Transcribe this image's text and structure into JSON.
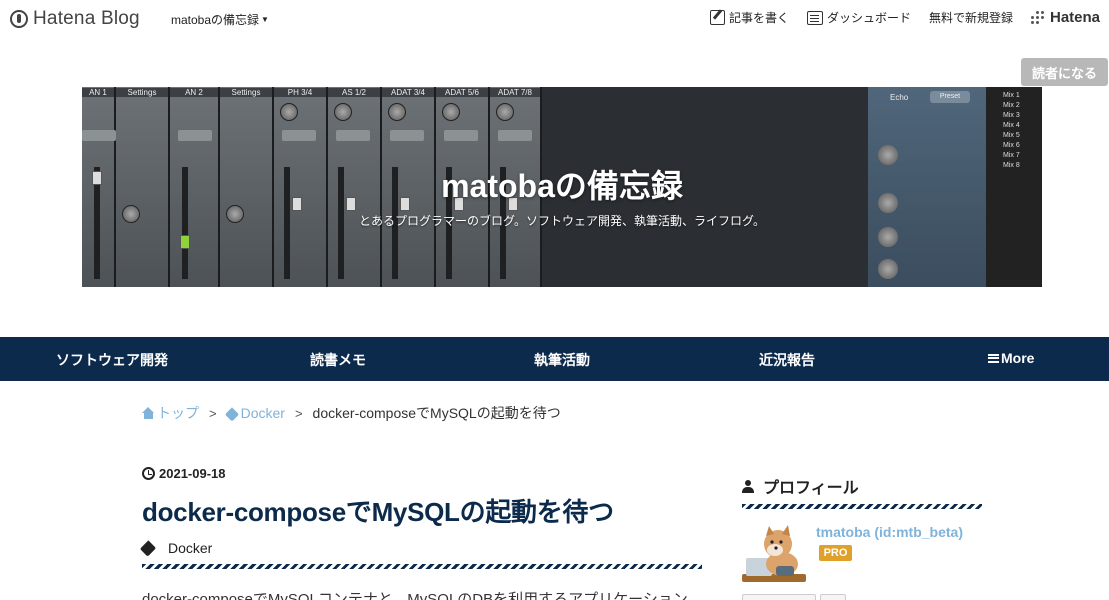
{
  "topbar": {
    "logo_text": "Hatena Blog",
    "blog_menu": "matobaの備忘録",
    "links": [
      {
        "label": "記事を書く",
        "icon": "edit-icon"
      },
      {
        "label": "ダッシュボード",
        "icon": "dashboard-icon"
      },
      {
        "label": "無料で新規登録",
        "icon": ""
      }
    ],
    "hatena_label": "Hatena"
  },
  "subscribe_button": "読者になる",
  "header": {
    "title": "matobaの備忘録",
    "description": "とあるプログラマーのブログ。ソフトウェア開発、執筆活動、ライフログ。",
    "image_labels": {
      "strips": [
        "AN 1",
        "Settings",
        "AN 2",
        "Settings",
        "PH 3/4",
        "AS 1/2",
        "ADAT 3/4",
        "ADAT 5/6",
        "ADAT 7/8"
      ],
      "echo": "Echo",
      "preset": "Preset",
      "mix": [
        "Mix 1",
        "Mix 2",
        "Mix 3",
        "Mix 4",
        "Mix 5",
        "Mix 6",
        "Mix 7",
        "Mix 8"
      ]
    }
  },
  "nav": {
    "items": [
      "ソフトウェア開発",
      "読書メモ",
      "執筆活動",
      "近況報告"
    ],
    "more": "More"
  },
  "breadcrumb": {
    "home": "トップ",
    "category": "Docker",
    "current": "docker-composeでMySQLの起動を待つ",
    "separator": ">"
  },
  "article": {
    "date": "2021-09-18",
    "title": "docker-composeでMySQLの起動を待つ",
    "category": "Docker",
    "body_start": "docker-composeでMySQLコンテナと、MySQLのDBを利用するアプリケーション"
  },
  "sidebar": {
    "heading": "プロフィール",
    "username": "tmatoba (id:mtb_beta)",
    "badge": "PRO"
  },
  "colors": {
    "nav_bg": "#0c2a4b",
    "link": "#7fb3d9",
    "pro_badge": "#e0a12b",
    "subscribe_bg": "#b8b8b8"
  }
}
